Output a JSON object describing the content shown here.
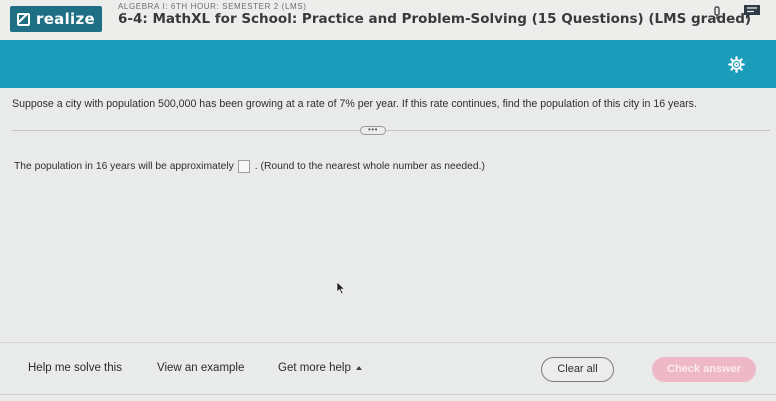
{
  "header": {
    "logo_text": "realize",
    "course": "ALGEBRA I: 6TH HOUR: SEMESTER 2 (LMS)",
    "assignment_title": "6-4: MathXL for School: Practice and Problem-Solving (15 Questions) (LMS graded)"
  },
  "colors": {
    "brand_teal": "#1b9cba",
    "logo_bg": "#1f6f84",
    "check_answer_disabled": "#efb8c7"
  },
  "icons": [
    "pencil-icon",
    "pin-icon",
    "chat-icon",
    "gear-icon",
    "more-dots-icon",
    "caret-up-icon",
    "mouse-cursor-icon"
  ],
  "question": {
    "text": "Suppose a city with population 500,000 has been growing at a rate of 7% per year. If this rate continues, find the population of this city in 16 years.",
    "more_label": "•••",
    "answer_prefix": "The population in 16 years will be approximately",
    "answer_value": "",
    "answer_suffix": ". (Round to the nearest whole number as needed.)"
  },
  "footer": {
    "help_label": "Help me solve this",
    "example_label": "View an example",
    "more_help_label": "Get more help",
    "clear_label": "Clear all",
    "check_label": "Check answer"
  }
}
